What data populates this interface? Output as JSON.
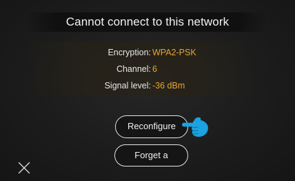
{
  "dialog": {
    "title": "Cannot connect to this network"
  },
  "network_info": {
    "encryption_label": "Encryption:",
    "encryption_value": "WPA2-PSK",
    "channel_label": "Channel:",
    "channel_value": "6",
    "signal_label": "Signal level:",
    "signal_value": "-36 dBm",
    "value_color": "#e8a533"
  },
  "actions": {
    "reconfigure_label": "Reconfigure",
    "forget_label": "Forget a"
  },
  "icons": {
    "pointer": "pointing-hand-icon",
    "close": "close-icon"
  },
  "colors": {
    "pointer_hand": "#1aa3e0",
    "background": "#1b1b1b",
    "text": "#f2f2f2"
  }
}
